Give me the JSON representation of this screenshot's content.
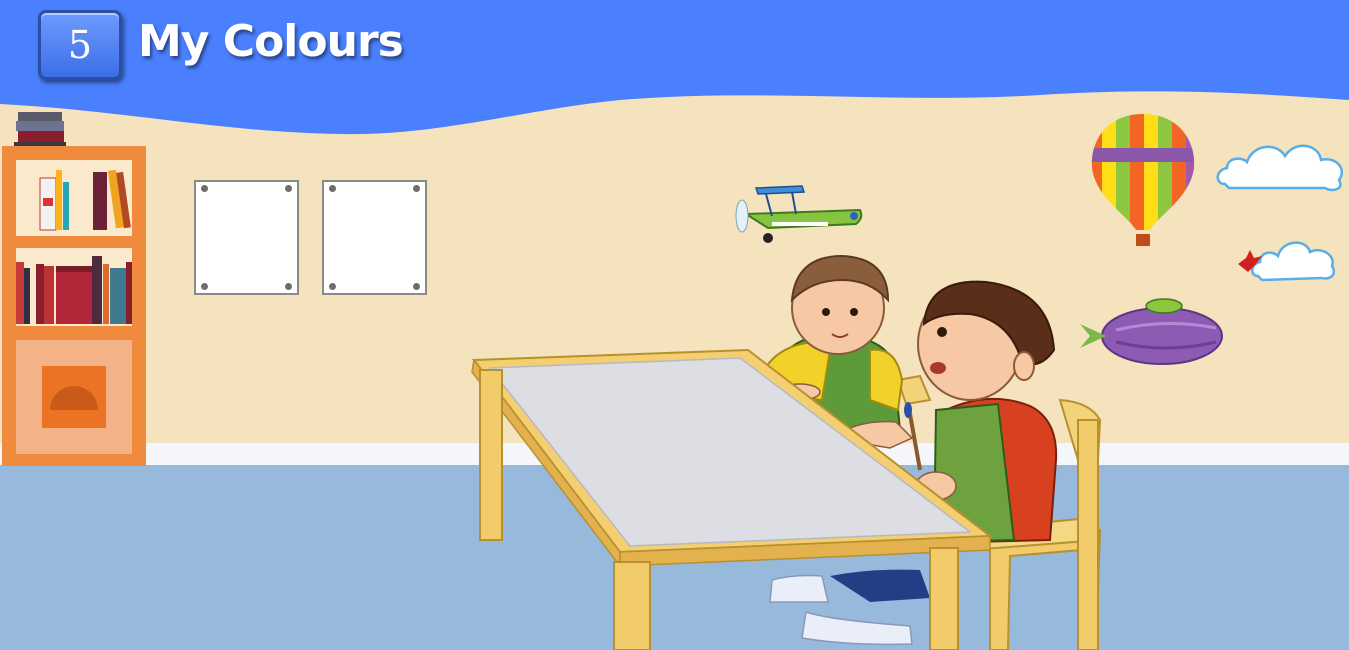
{
  "header": {
    "unit_number": "5",
    "unit_title": "My Colours"
  },
  "scene": {
    "description_icons": [
      "bookshelf-icon",
      "airplane-icon",
      "hot-air-balloon-icon",
      "cloud-icon",
      "bird-icon",
      "blimp-icon",
      "boy-icon",
      "toddler-icon",
      "table-icon",
      "chair-icon",
      "paintbrush-icon"
    ],
    "colors": {
      "header_blue": "#4a7ffe",
      "wall": "#f5e3be",
      "floor": "#97b9db",
      "shelf_orange": "#f08a3c"
    },
    "picture_frames": [
      "blank",
      "blank"
    ]
  }
}
